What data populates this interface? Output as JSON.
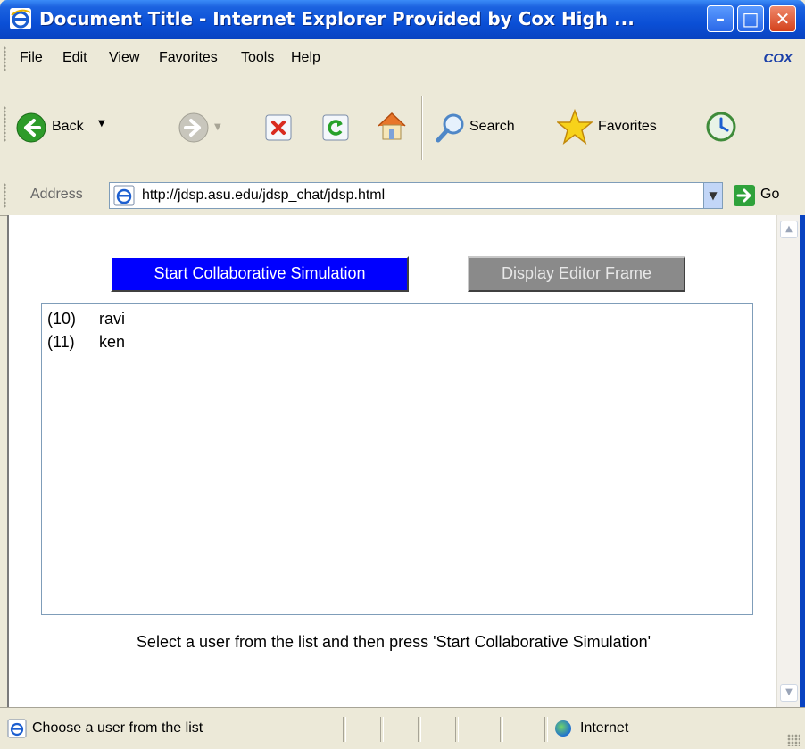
{
  "window": {
    "title": "Document Title - Internet Explorer Provided by Cox High ...",
    "controls": {
      "minimize": "–",
      "maximize": "□",
      "close": "✕"
    }
  },
  "menu": {
    "items": [
      {
        "label": "File"
      },
      {
        "label": "Edit"
      },
      {
        "label": "View"
      },
      {
        "label": "Favorites"
      },
      {
        "label": "Tools"
      },
      {
        "label": "Help"
      }
    ],
    "brand": "COX"
  },
  "toolbar": {
    "back_label": "Back",
    "search_label": "Search",
    "favorites_label": "Favorites"
  },
  "address": {
    "label": "Address",
    "url": "http://jdsp.asu.edu/jdsp_chat/jdsp.html",
    "go_label": "Go"
  },
  "page": {
    "start_button": "Start Collaborative Simulation",
    "editor_button": "Display Editor Frame",
    "users": [
      {
        "id": "(10)",
        "name": "ravi"
      },
      {
        "id": "(11)",
        "name": "ken"
      }
    ],
    "instruction": "Select a user from the list and then press 'Start Collaborative Simulation'"
  },
  "status": {
    "text": "Choose a user from the list",
    "zone": "Internet"
  },
  "colors": {
    "start_button_bg": "#0000ff",
    "editor_button_bg": "#8a8a8a",
    "titlebar": "#0a4fd6"
  }
}
